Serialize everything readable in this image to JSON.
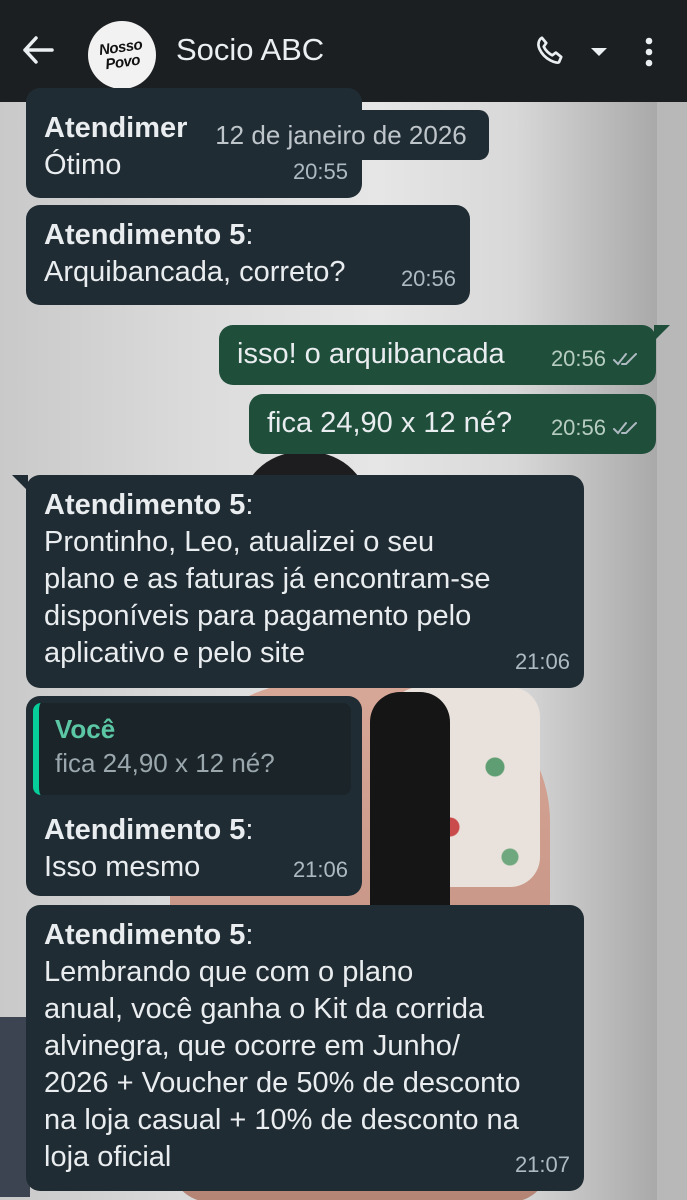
{
  "header": {
    "title": "Socio ABC",
    "avatar_line1": "Nosso",
    "avatar_line2": "Povo",
    "back_icon": "arrow-left-icon",
    "call_icon": "phone-icon",
    "menu_icon": "more-vertical-icon"
  },
  "date_separator": "12 de janeiro de 2026",
  "messages": [
    {
      "sender": "Atendimer",
      "colon": "",
      "text": "Ótimo",
      "time": "20:55",
      "direction": "in"
    },
    {
      "sender": "Atendimento 5",
      "colon": ":",
      "text": "Arquibancada, correto?",
      "time": "20:56",
      "direction": "in"
    },
    {
      "text": "isso! o arquibancada",
      "time": "20:56",
      "direction": "out"
    },
    {
      "text": "fica 24,90 x 12 né?",
      "time": "20:56",
      "direction": "out"
    },
    {
      "sender": "Atendimento 5",
      "colon": ":",
      "lines": [
        "Prontinho, Leo, atualizei o seu",
        "plano e as faturas já encontram-se",
        "disponíveis para pagamento pelo",
        "aplicativo e pelo site"
      ],
      "time": "21:06",
      "direction": "in"
    },
    {
      "quote_name": "Você",
      "quote_text": "fica 24,90 x 12 né?",
      "sender": "Atendimento 5",
      "colon": ":",
      "text": "Isso mesmo",
      "time": "21:06",
      "direction": "in"
    },
    {
      "sender": "Atendimento 5",
      "colon": ":",
      "lines": [
        "Lembrando que com o plano",
        "anual, você ganha o Kit da corrida",
        "alvinegra, que ocorre em Junho/",
        "2026 + Voucher de 50% de desconto",
        "na loja casual + 10% de desconto na",
        "loja oficial"
      ],
      "time": "21:07",
      "direction": "in"
    }
  ],
  "colors": {
    "header_bg": "#1c1f21",
    "incoming_bubble": "#202c33",
    "outgoing_bubble": "#1f4e3b",
    "quote_accent": "#06cf9c"
  }
}
